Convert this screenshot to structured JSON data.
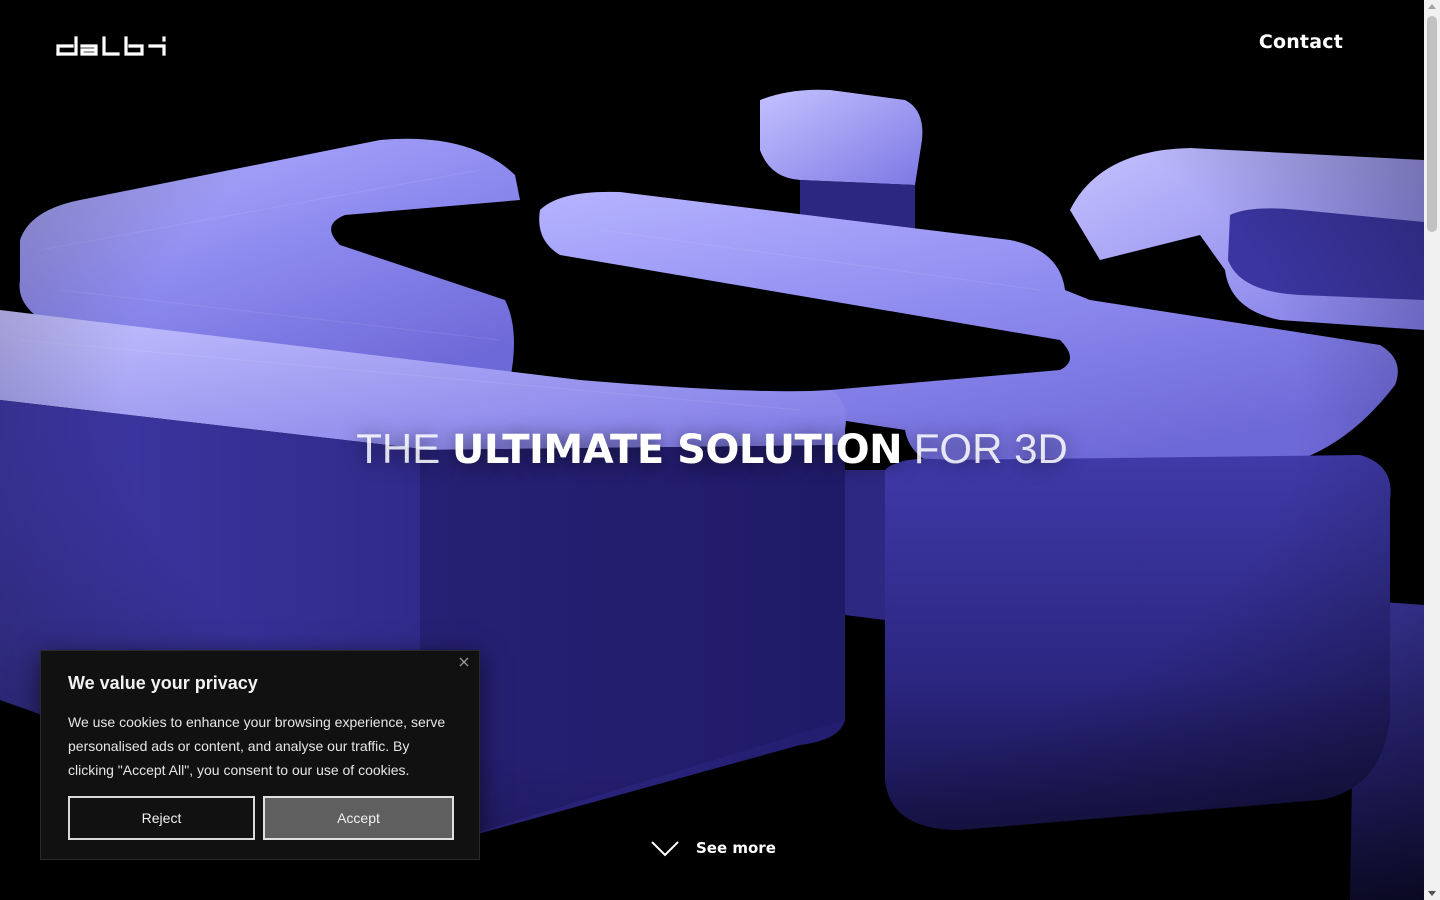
{
  "header": {
    "logo_text": "dalbi",
    "contact_label": "Contact"
  },
  "hero": {
    "headline_light_1": "THE ",
    "headline_bold": "ULTIMATE SOLUTION",
    "headline_light_2": " FOR 3D",
    "see_more_label": "See more",
    "accent_color": "#5b54d6"
  },
  "cookie_banner": {
    "title": "We value your privacy",
    "text": "We use cookies to enhance your browsing experience, serve personalised ads or content, and analyse our traffic. By clicking \"Accept All\", you consent to our use of cookies.",
    "reject_label": "Reject",
    "accept_label": "Accept"
  }
}
